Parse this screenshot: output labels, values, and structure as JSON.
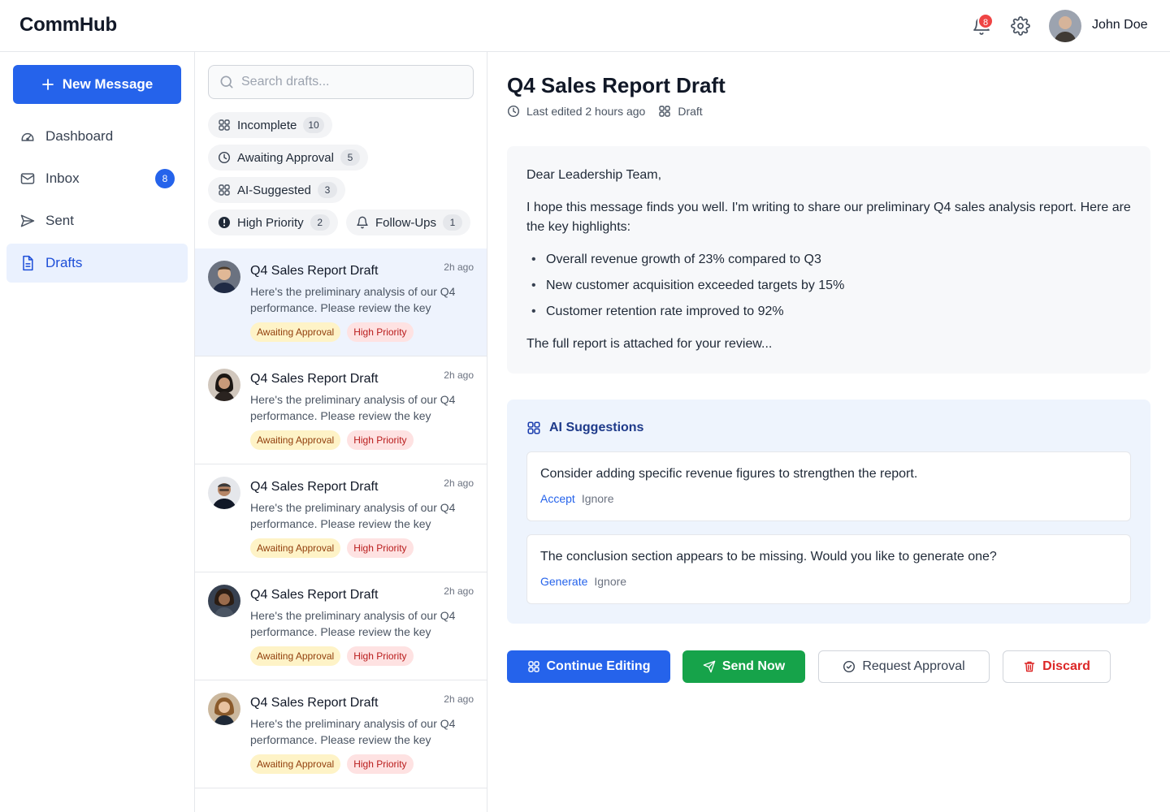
{
  "app": {
    "brand": "CommHub"
  },
  "header": {
    "notifications_count": "8",
    "user_name": "John Doe"
  },
  "sidebar": {
    "new_message_label": "New Message",
    "items": [
      {
        "label": "Dashboard",
        "icon": "dashboard-icon"
      },
      {
        "label": "Inbox",
        "icon": "inbox-icon",
        "badge": "8"
      },
      {
        "label": "Sent",
        "icon": "send-icon"
      },
      {
        "label": "Drafts",
        "icon": "document-icon",
        "active": true
      }
    ]
  },
  "drafts_list": {
    "search_placeholder": "Search drafts...",
    "filters": [
      {
        "label": "Incomplete",
        "count": "10",
        "icon": "grid-icon"
      },
      {
        "label": "Awaiting Approval",
        "count": "5",
        "icon": "clock-icon"
      },
      {
        "label": "AI-Suggested",
        "count": "3",
        "icon": "grid-icon"
      },
      {
        "label": "High Priority",
        "count": "2",
        "icon": "alert-icon"
      },
      {
        "label": "Follow-Ups",
        "count": "1",
        "icon": "bell-icon"
      }
    ],
    "items": [
      {
        "title": "Q4 Sales Report Draft",
        "time": "2h ago",
        "preview": "Here's the preliminary analysis of our Q4 performance. Please review the key",
        "tags": [
          "Awaiting Approval",
          "High Priority"
        ]
      },
      {
        "title": "Q4 Sales Report Draft",
        "time": "2h ago",
        "preview": "Here's the preliminary analysis of our Q4 performance. Please review the key",
        "tags": [
          "Awaiting Approval",
          "High Priority"
        ]
      },
      {
        "title": "Q4 Sales Report Draft",
        "time": "2h ago",
        "preview": "Here's the preliminary analysis of our Q4 performance. Please review the key",
        "tags": [
          "Awaiting Approval",
          "High Priority"
        ]
      },
      {
        "title": "Q4 Sales Report Draft",
        "time": "2h ago",
        "preview": "Here's the preliminary analysis of our Q4 performance. Please review the key",
        "tags": [
          "Awaiting Approval",
          "High Priority"
        ]
      },
      {
        "title": "Q4 Sales Report Draft",
        "time": "2h ago",
        "preview": "Here's the preliminary analysis of our Q4 performance. Please review the key",
        "tags": [
          "Awaiting Approval",
          "High Priority"
        ]
      }
    ]
  },
  "detail": {
    "title": "Q4 Sales Report Draft",
    "last_edited": "Last edited 2 hours ago",
    "status": "Draft",
    "greeting": "Dear Leadership Team,",
    "intro": "I hope this message finds you well. I'm writing to share our preliminary Q4 sales analysis report. Here are the key highlights:",
    "bullets": [
      "Overall revenue growth of 23% compared to Q3",
      "New customer acquisition exceeded targets by 15%",
      "Customer retention rate improved to 92%"
    ],
    "closing": "The full report is attached for your review..."
  },
  "ai_suggestions": {
    "heading": "AI Suggestions",
    "items": [
      {
        "text": "Consider adding specific revenue figures to strengthen the report.",
        "primary_action": "Accept",
        "secondary_action": "Ignore"
      },
      {
        "text": "The conclusion section appears to be missing. Would you like to generate one?",
        "primary_action": "Generate",
        "secondary_action": "Ignore"
      }
    ]
  },
  "actions": {
    "continue_editing": "Continue Editing",
    "send_now": "Send Now",
    "request_approval": "Request Approval",
    "discard": "Discard"
  },
  "colors": {
    "primary": "#2563eb",
    "success": "#16a34a",
    "danger": "#dc2626",
    "selected_bg": "#eef3fd"
  }
}
